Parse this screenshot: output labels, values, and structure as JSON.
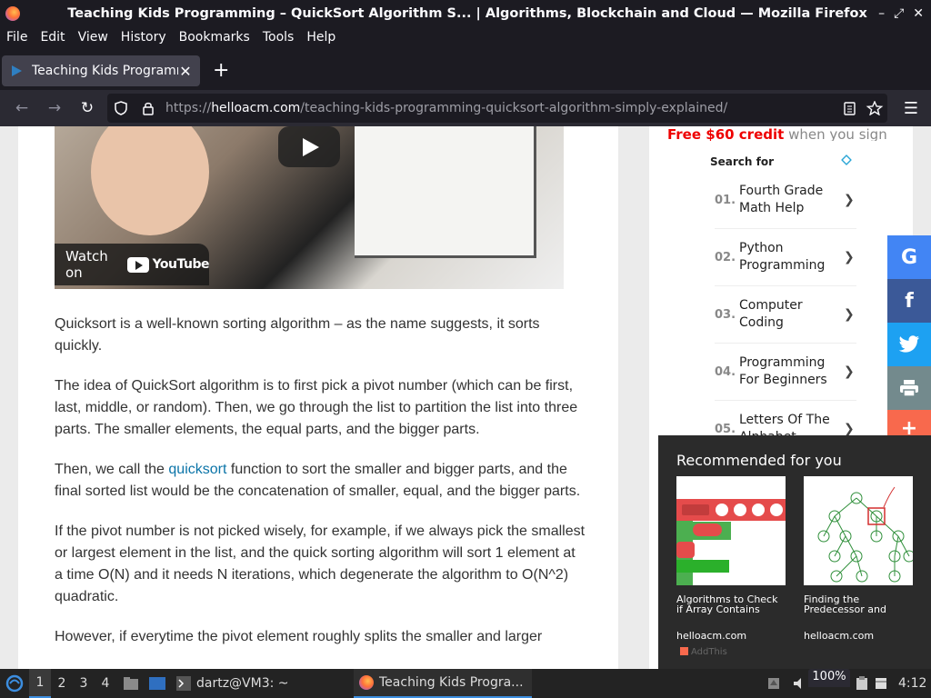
{
  "window": {
    "title": "Teaching Kids Programming – QuickSort Algorithm S... | Algorithms, Blockchain and Cloud — Mozilla Firefox",
    "controls": [
      "–",
      "⤢",
      "✕"
    ]
  },
  "menubar": [
    "File",
    "Edit",
    "View",
    "History",
    "Bookmarks",
    "Tools",
    "Help"
  ],
  "tab": {
    "title": "Teaching Kids Programming",
    "close": "✕",
    "new_tab": "+"
  },
  "navbar": {
    "back": "←",
    "forward": "→",
    "reload": "↻",
    "url_prefix": "https://",
    "url_host": "helloacm.com",
    "url_path": "/teaching-kids-programming-quicksort-algorithm-simply-explained/",
    "menu": "☰"
  },
  "video": {
    "watch_on": "Watch on",
    "youtube": "YouTube"
  },
  "article": {
    "p1": "Quicksort is a well-known sorting algorithm – as the name suggests, it sorts quickly.",
    "p2": "The idea of QuickSort algorithm is to first pick a pivot number (which can be first, last, middle, or random). Then, we go through the list to partition the list into three parts. The smaller elements, the equal parts, and the bigger parts.",
    "p3_before": "Then, we call the ",
    "p3_link": "quicksort",
    "p3_after": " function to sort the smaller and bigger parts, and the final sorted list would be the concatenation of smaller, equal, and the bigger parts.",
    "p4": "If the pivot number is not picked wisely, for example, if we always pick the smallest or largest element in the list, and the quick sorting algorithm will sort 1 element at a time O(N) and it needs N iterations, which degenerate the algorithm to O(N^2) quadratic.",
    "p5": "However, if everytime the pivot element roughly splits the smaller and larger"
  },
  "sidebar": {
    "ad_top_red": "Free $60 credit",
    "ad_top_gray": " when you sign",
    "search_for": "Search for",
    "items": [
      {
        "num": "01.",
        "label": "Fourth Grade Math Help"
      },
      {
        "num": "02.",
        "label": "Python Programming"
      },
      {
        "num": "03.",
        "label": "Computer Coding"
      },
      {
        "num": "04.",
        "label": "Programming For Beginners"
      },
      {
        "num": "05.",
        "label": "Letters Of The Alphabet"
      }
    ]
  },
  "social": [
    {
      "name": "google",
      "glyph": "G",
      "color": "#4285f4"
    },
    {
      "name": "facebook",
      "glyph": "f",
      "color": "#3b5998"
    },
    {
      "name": "twitter",
      "glyph": "🐦",
      "color": "#1da1f2"
    },
    {
      "name": "print",
      "glyph": "🖶",
      "color": "#738a8d"
    },
    {
      "name": "more",
      "glyph": "+",
      "color": "#f8694d"
    }
  ],
  "recommended": {
    "heading": "Recommended for you",
    "cards": [
      {
        "caption": "Algorithms to Check if Array Contains Duplic...",
        "source": "helloacm.com"
      },
      {
        "caption": "Finding the Predecessor and Suc...",
        "source": "helloacm.com"
      }
    ],
    "addthis": "AddThis"
  },
  "taskbar": {
    "workspaces": [
      "1",
      "2",
      "3",
      "4"
    ],
    "terminal": "dartz@VM3: ~",
    "firefox_task": "Teaching Kids Progra...",
    "zoom": "100%",
    "clock": "4:12"
  }
}
